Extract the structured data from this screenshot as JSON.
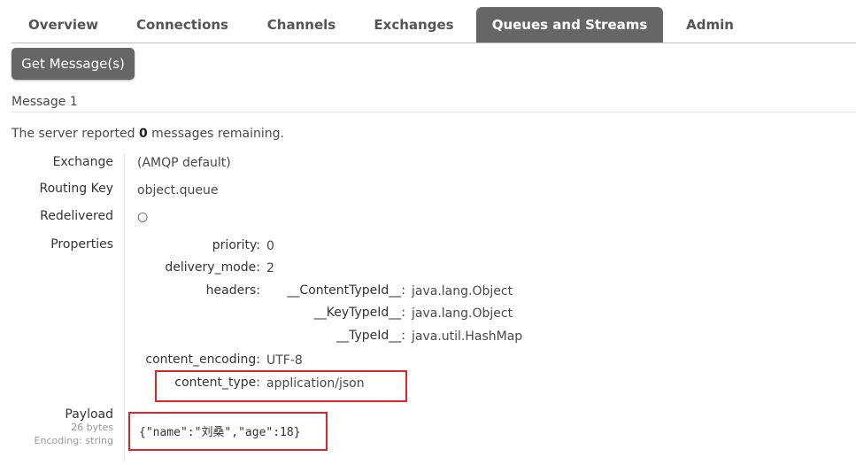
{
  "tabs": [
    {
      "label": "Overview",
      "active": false
    },
    {
      "label": "Connections",
      "active": false
    },
    {
      "label": "Channels",
      "active": false
    },
    {
      "label": "Exchanges",
      "active": false
    },
    {
      "label": "Queues and Streams",
      "active": true
    },
    {
      "label": "Admin",
      "active": false
    }
  ],
  "get_button_label": "Get Message(s)",
  "message": {
    "title": "Message 1",
    "server_prefix": "The server reported ",
    "remaining_count": "0",
    "server_suffix": " messages remaining.",
    "labels": {
      "exchange": "Exchange",
      "routing_key": "Routing Key",
      "redelivered": "Redelivered",
      "properties": "Properties",
      "payload": "Payload"
    },
    "exchange": "(AMQP default)",
    "routing_key": "object.queue",
    "redelivered": "○",
    "properties": {
      "priority_key": "priority:",
      "priority": "0",
      "delivery_mode_key": "delivery_mode:",
      "delivery_mode": "2",
      "headers_key": "headers:",
      "headers": [
        {
          "key": "__ContentTypeId__:",
          "value": "java.lang.Object"
        },
        {
          "key": "__KeyTypeId__:",
          "value": "java.lang.Object"
        },
        {
          "key": "__TypeId__:",
          "value": "java.util.HashMap"
        }
      ],
      "content_encoding_key": "content_encoding:",
      "content_encoding": "UTF-8",
      "content_type_key": "content_type:",
      "content_type": "application/json"
    },
    "payload_size": "26 bytes",
    "payload_encoding": "Encoding: string",
    "payload": "{\"name\":\"刘桑\",\"age\":18}"
  },
  "colors": {
    "tab_active": "#666666",
    "highlight": "#d9262b"
  }
}
